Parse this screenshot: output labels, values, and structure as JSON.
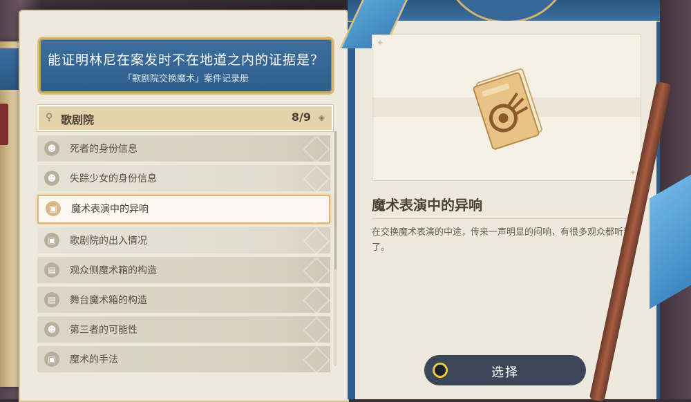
{
  "question": {
    "title": "能证明林尼在案发时不在地道之内的证据是？",
    "subtitle": "「歌剧院交换魔术」案件记录册"
  },
  "location": {
    "name": "歌剧院",
    "count": "8/9",
    "pin_icon": "map-pin-icon",
    "gem_icon": "diamond-icon"
  },
  "clues": [
    {
      "label": "死者的身份信息",
      "icon": "person-icon",
      "selected": false
    },
    {
      "label": "失踪少女的身份信息",
      "icon": "person-icon",
      "selected": false
    },
    {
      "label": "魔术表演中的异响",
      "icon": "clue-card-icon",
      "selected": true
    },
    {
      "label": "歌剧院的出入情况",
      "icon": "clue-card-icon",
      "selected": false
    },
    {
      "label": "观众侧魔术箱的构造",
      "icon": "box-icon",
      "selected": false
    },
    {
      "label": "舞台魔术箱的构造",
      "icon": "box-icon",
      "selected": false
    },
    {
      "label": "第三者的可能性",
      "icon": "person-icon",
      "selected": false
    },
    {
      "label": "魔术的手法",
      "icon": "clue-card-icon",
      "selected": false
    }
  ],
  "detail": {
    "title": "魔术表演中的异响",
    "description": "在交换魔术表演的中途，传来一声明显的闷响，有很多观众都听到了。",
    "image_icon": "document-book-icon"
  },
  "action": {
    "select_label": "选择"
  },
  "colors": {
    "banner_blue": "#2f5d8b",
    "panel_bg": "#efe9dd",
    "selected_border": "#e7b26c",
    "button_bg": "#3b4658",
    "button_ring": "#f3c93c"
  }
}
